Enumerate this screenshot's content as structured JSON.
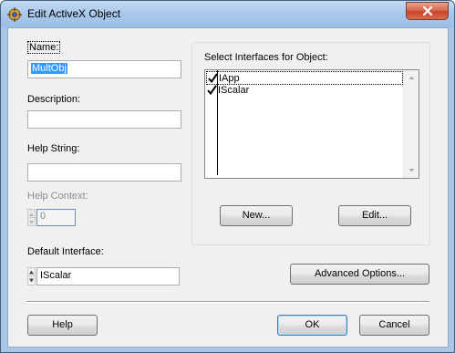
{
  "window": {
    "title": "Edit ActiveX Object",
    "close_glyph": "✕"
  },
  "fields": {
    "name_label": "Name:",
    "name_value": "MultObj",
    "description_label": "Description:",
    "description_value": "",
    "help_string_label": "Help String:",
    "help_string_value": "",
    "help_context_label": "Help Context:",
    "help_context_value": "0",
    "default_interface_label": "Default Interface:",
    "default_interface_value": "IScalar"
  },
  "interfaces": {
    "group_label": "Select Interfaces for Object:",
    "items": [
      {
        "label": "IApp",
        "checked": true,
        "focused": true
      },
      {
        "label": "IScalar",
        "checked": true,
        "focused": false
      }
    ],
    "new_button": "New...",
    "edit_button": "Edit..."
  },
  "buttons": {
    "advanced": "Advanced Options...",
    "help": "Help",
    "ok": "OK",
    "cancel": "Cancel"
  },
  "icons": {
    "app": "activex-gear-icon",
    "close": "close-icon",
    "check": "checkmark-icon",
    "scroll_up": "scroll-up-arrow-icon",
    "scroll_down": "scroll-down-arrow-icon",
    "spin_up": "spin-up-arrow-icon",
    "spin_down": "spin-down-arrow-icon"
  }
}
